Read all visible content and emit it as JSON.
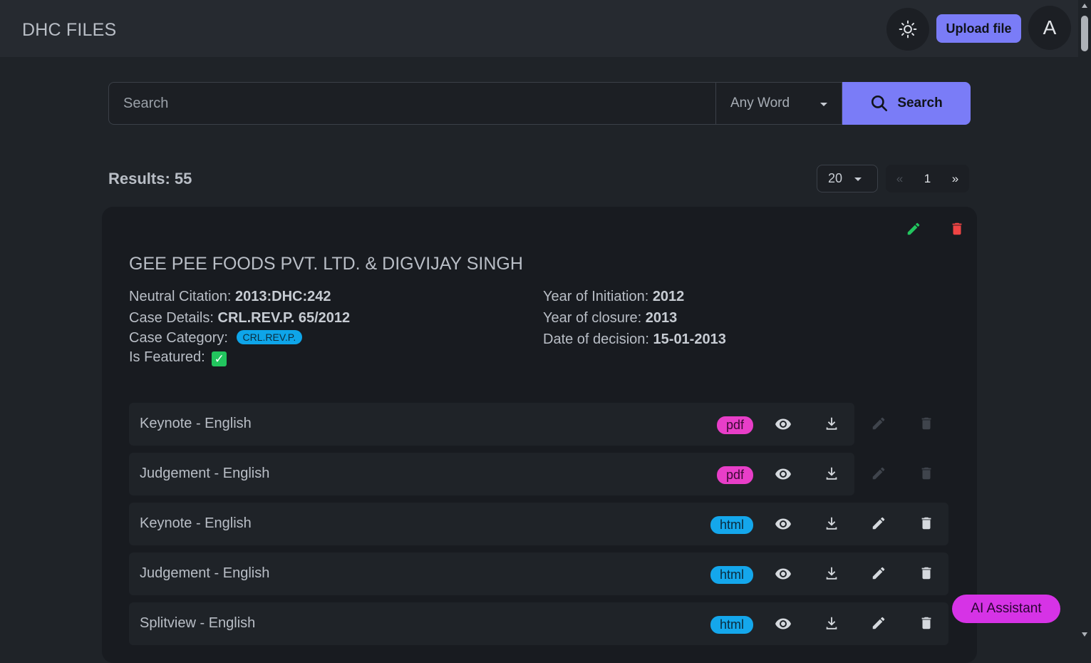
{
  "app": {
    "title": "DHC FILES"
  },
  "header": {
    "upload_label": "Upload file",
    "avatar_letter": "A",
    "theme_icon": "sun-icon"
  },
  "search": {
    "placeholder": "Search",
    "mode": "Any Word",
    "button_label": "Search"
  },
  "results": {
    "label": "Results: 55"
  },
  "pagination": {
    "per_page": "20",
    "prev": "«",
    "current": "1",
    "next": "»"
  },
  "case": {
    "title": "GEE PEE FOODS PVT. LTD. & DIGVIJAY SINGH",
    "neutral_citation_label": "Neutral Citation: ",
    "neutral_citation": "2013:DHC:242",
    "case_details_label": "Case Details: ",
    "case_details": "CRL.REV.P. 65/2012",
    "case_category_label": "Case Category: ",
    "case_category": "CRL.REV.P.",
    "is_featured_label": "Is Featured: ",
    "is_featured_mark": "✓",
    "year_initiation_label": "Year of Initiation: ",
    "year_initiation": "2012",
    "year_closure_label": "Year of closure: ",
    "year_closure": "2013",
    "date_decision_label": "Date of decision: ",
    "date_decision": "15-01-2013"
  },
  "files": [
    {
      "label": "Keynote - English",
      "type": "pdf",
      "editable": false
    },
    {
      "label": "Judgement - English",
      "type": "pdf",
      "editable": false
    },
    {
      "label": "Keynote - English",
      "type": "html",
      "editable": true
    },
    {
      "label": "Judgement - English",
      "type": "html",
      "editable": true
    },
    {
      "label": "Splitview - English",
      "type": "html",
      "editable": true
    }
  ],
  "assistant": {
    "label": "AI Assistant"
  },
  "colors": {
    "accent": "#7a7cf7",
    "pdf": "#e83ec8",
    "html": "#14a7ec",
    "edit": "#22c55e",
    "delete": "#ef4444",
    "assistant": "#d633e6"
  }
}
